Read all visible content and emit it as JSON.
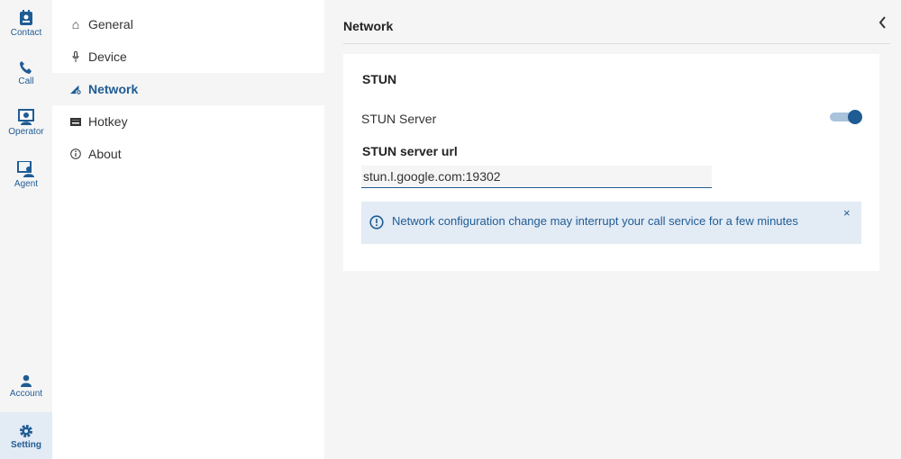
{
  "rail": {
    "items": [
      {
        "label": "Contact",
        "icon": "contact-icon"
      },
      {
        "label": "Call",
        "icon": "phone-icon"
      },
      {
        "label": "Operator",
        "icon": "operator-icon"
      },
      {
        "label": "Agent",
        "icon": "agent-icon"
      },
      {
        "label": "Account",
        "icon": "account-icon"
      },
      {
        "label": "Setting",
        "icon": "gear-icon"
      }
    ]
  },
  "menu": {
    "items": [
      {
        "label": "General"
      },
      {
        "label": "Device"
      },
      {
        "label": "Network"
      },
      {
        "label": "Hotkey"
      },
      {
        "label": "About"
      }
    ]
  },
  "main": {
    "title": "Network",
    "section": "STUN",
    "stun_label": "STUN Server",
    "stun_enabled": true,
    "url_label": "STUN server url",
    "url_value": "stun.l.google.com:19302",
    "alert": "Network configuration change may interrupt your call service for a few minutes",
    "alert_close": "×"
  },
  "colors": {
    "accent": "#1f5c94",
    "alert_bg": "#e3ebf5"
  }
}
